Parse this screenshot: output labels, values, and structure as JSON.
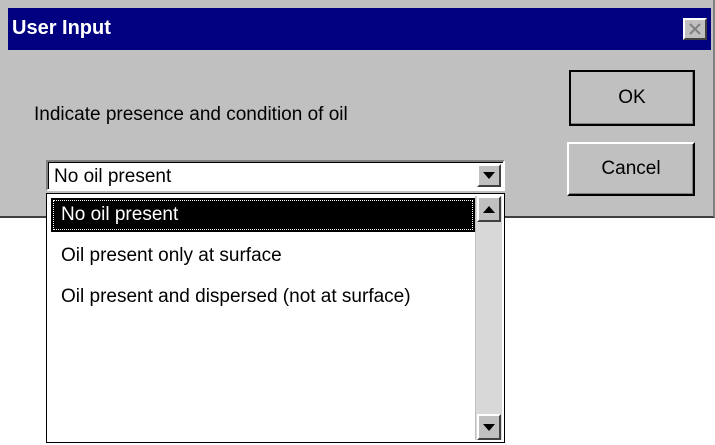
{
  "dialog": {
    "title": "User Input",
    "prompt": "Indicate presence and condition of oil",
    "ok_label": "OK",
    "cancel_label": "Cancel",
    "close_icon": "close-icon"
  },
  "combo": {
    "selected_value": "No oil present",
    "options": [
      "No oil present",
      "Oil present only at surface",
      "Oil present and dispersed (not at surface)"
    ],
    "selected_index": 0
  },
  "colors": {
    "title_bar": "#000080",
    "dialog_face": "#c0c0c0",
    "selection": "#000000"
  }
}
